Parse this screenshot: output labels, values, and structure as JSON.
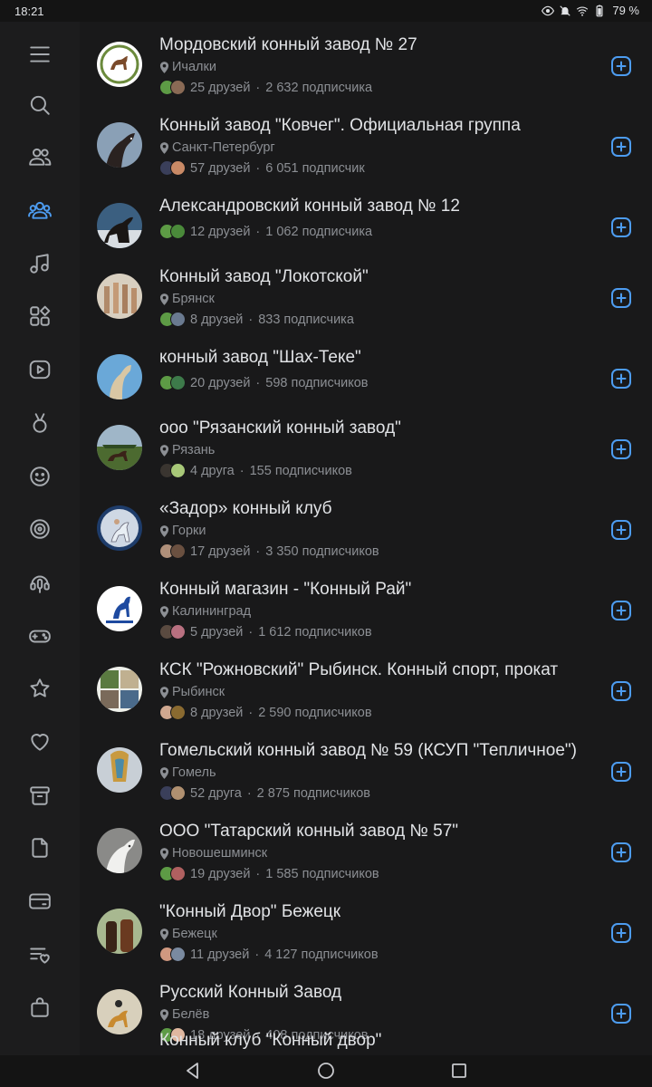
{
  "status_bar": {
    "time": "18:21",
    "battery": "79 %"
  },
  "colors": {
    "accent": "#4d9cf0",
    "secondary_text": "#8c8f94",
    "background": "#19191a"
  },
  "sidebar": {
    "items": [
      {
        "icon": "menu-icon"
      },
      {
        "icon": "search-icon"
      },
      {
        "icon": "friends-icon"
      },
      {
        "icon": "communities-icon",
        "active": true
      },
      {
        "icon": "music-icon"
      },
      {
        "icon": "services-icon"
      },
      {
        "icon": "video-icon"
      },
      {
        "icon": "clips-icon"
      },
      {
        "icon": "stickers-icon"
      },
      {
        "icon": "target-icon"
      },
      {
        "icon": "podcasts-icon"
      },
      {
        "icon": "games-icon"
      },
      {
        "icon": "bookmarks-icon"
      },
      {
        "icon": "favorites-icon"
      },
      {
        "icon": "archive-icon"
      },
      {
        "icon": "files-icon"
      },
      {
        "icon": "payments-icon"
      },
      {
        "icon": "wishlist-icon"
      },
      {
        "icon": "market-icon"
      }
    ]
  },
  "groups": [
    {
      "title": "Мордовский конный завод № 27",
      "city": "Ичалки",
      "friends": "25 друзей",
      "subscribers": "2 632 подписчика"
    },
    {
      "title": "Конный завод \"Ковчег\". Официальная группа",
      "city": "Санкт-Петербург",
      "friends": "57 друзей",
      "subscribers": "6 051 подписчик"
    },
    {
      "title": "Александровский конный завод № 12",
      "city": "",
      "friends": "12 друзей",
      "subscribers": "1 062 подписчика"
    },
    {
      "title": "Конный завод \"Локотской\"",
      "city": "Брянск",
      "friends": "8 друзей",
      "subscribers": "833 подписчика"
    },
    {
      "title": "конный завод \"Шах-Теке\"",
      "city": "",
      "friends": "20 друзей",
      "subscribers": "598 подписчиков"
    },
    {
      "title": "ооо \"Рязанский конный завод\"",
      "city": "Рязань",
      "friends": "4 друга",
      "subscribers": "155 подписчиков"
    },
    {
      "title": "«Задор» конный клуб",
      "city": "Горки",
      "friends": "17 друзей",
      "subscribers": "3 350 подписчиков"
    },
    {
      "title": "Конный магазин - \"Конный Рай\"",
      "city": "Калининград",
      "friends": "5 друзей",
      "subscribers": "1 612 подписчиков"
    },
    {
      "title": "КСК \"Рожновский\" Рыбинск. Конный спорт, прокат",
      "city": "Рыбинск",
      "friends": "8 друзей",
      "subscribers": "2 590 подписчиков"
    },
    {
      "title": "Гомельский конный завод № 59  (КСУП \"Тепличное\")",
      "city": "Гомель",
      "friends": "52 друга",
      "subscribers": "2 875 подписчиков"
    },
    {
      "title": "ООО \"Татарский конный завод № 57\"",
      "city": "Новошешминск",
      "friends": "19 друзей",
      "subscribers": "1 585 подписчиков"
    },
    {
      "title": "\"Конный Двор\" Бежецк",
      "city": "Бежецк",
      "friends": "11 друзей",
      "subscribers": "4 127 подписчиков"
    },
    {
      "title": "Русский Конный Завод",
      "city": "Белёв",
      "friends": "18 друзей",
      "subscribers": "408 подписчиков"
    }
  ],
  "partial_row_text": "Конный клуб \"Конный двор\""
}
